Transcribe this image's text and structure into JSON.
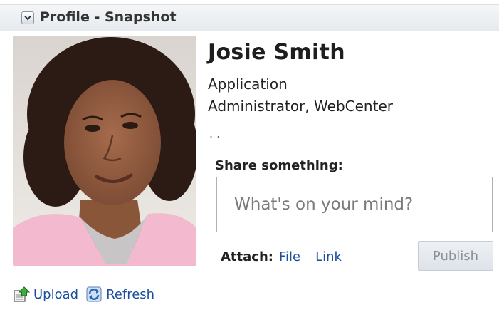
{
  "header": {
    "title": "Profile - Snapshot"
  },
  "profile": {
    "name": "Josie Smith",
    "title_line1": "Application",
    "title_line2": "Administrator, WebCenter",
    "extra": ". ."
  },
  "share": {
    "label": "Share something:",
    "placeholder": "What's on your mind?",
    "value": ""
  },
  "attach": {
    "label": "Attach:",
    "file_label": "File",
    "link_label": "Link"
  },
  "publish_label": "Publish",
  "footer": {
    "upload_label": "Upload",
    "refresh_label": "Refresh"
  },
  "colors": {
    "link": "#1a4f9c",
    "header_bg": "#e6eaee",
    "publish_text": "#8a8f95"
  },
  "icons": [
    "chevron-down-icon",
    "upload-icon",
    "refresh-icon"
  ]
}
